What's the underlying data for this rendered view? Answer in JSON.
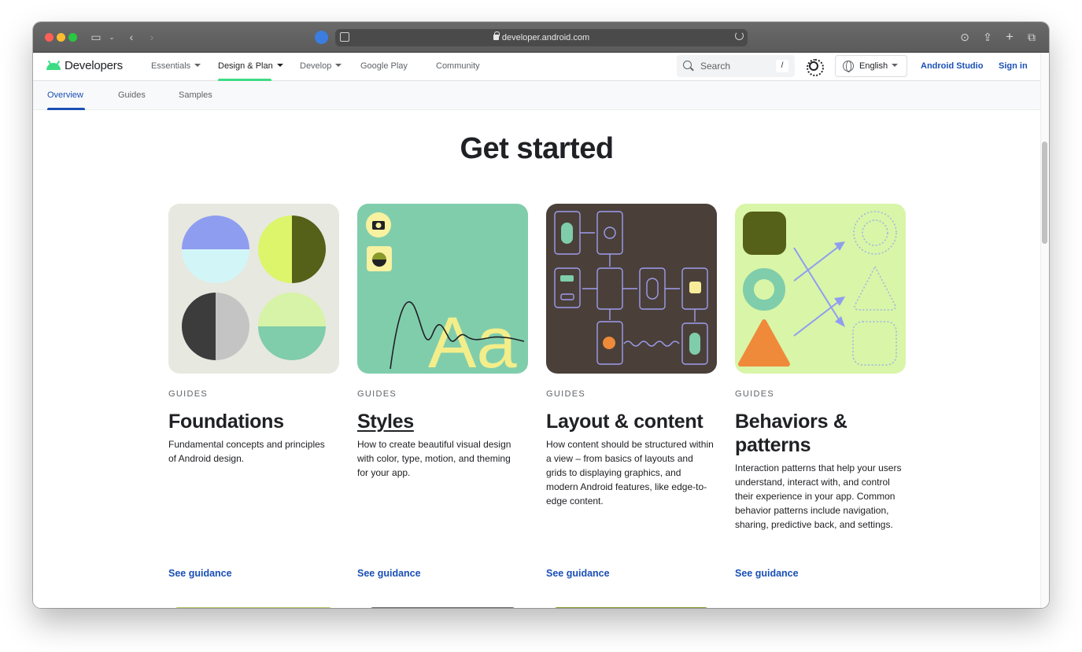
{
  "browser": {
    "url": "developer.android.com"
  },
  "site": {
    "logo": "Developers",
    "nav": [
      {
        "label": "Essentials",
        "dropdown": true
      },
      {
        "label": "Design & Plan",
        "dropdown": true,
        "active": true
      },
      {
        "label": "Develop",
        "dropdown": true
      },
      {
        "label": "Google Play",
        "dropdown": false
      },
      {
        "label": "Community",
        "dropdown": false
      }
    ],
    "search": {
      "placeholder": "Search",
      "shortcut": "/"
    },
    "language": "English",
    "android_studio": "Android Studio",
    "sign_in": "Sign in"
  },
  "subnav": {
    "tabs": [
      "Overview",
      "Guides",
      "Samples"
    ],
    "active": "Overview"
  },
  "main": {
    "heading": "Get started",
    "cards": [
      {
        "eyebrow": "GUIDES",
        "title": "Foundations",
        "description": "Fundamental concepts and principles of Android design.",
        "link": "See guidance"
      },
      {
        "eyebrow": "GUIDES",
        "title": "Styles",
        "description": "How to create beautiful visual design with color, type, motion, and theming for your app.",
        "link": "See guidance"
      },
      {
        "eyebrow": "GUIDES",
        "title": "Layout & content",
        "description": "How content should be structured within a view – from basics of layouts and grids to displaying graphics, and modern Android features, like edge-to-edge content.",
        "link": "See guidance"
      },
      {
        "eyebrow": "GUIDES",
        "title": "Behaviors & patterns",
        "description": "Interaction patterns that help your users understand, interact with, and control their experience in your app. Common behavior patterns include navigation, sharing, predictive back, and settings.",
        "link": "See guidance"
      }
    ]
  },
  "colors": {
    "link_blue": "#1a4fb5",
    "android_green": "#3ddc84",
    "styles_art_bg": "#80cdac",
    "layout_art_bg": "#4a4039",
    "behaviors_art_bg": "#d9f5a8",
    "foundations_art_bg": "#e7e8df"
  }
}
